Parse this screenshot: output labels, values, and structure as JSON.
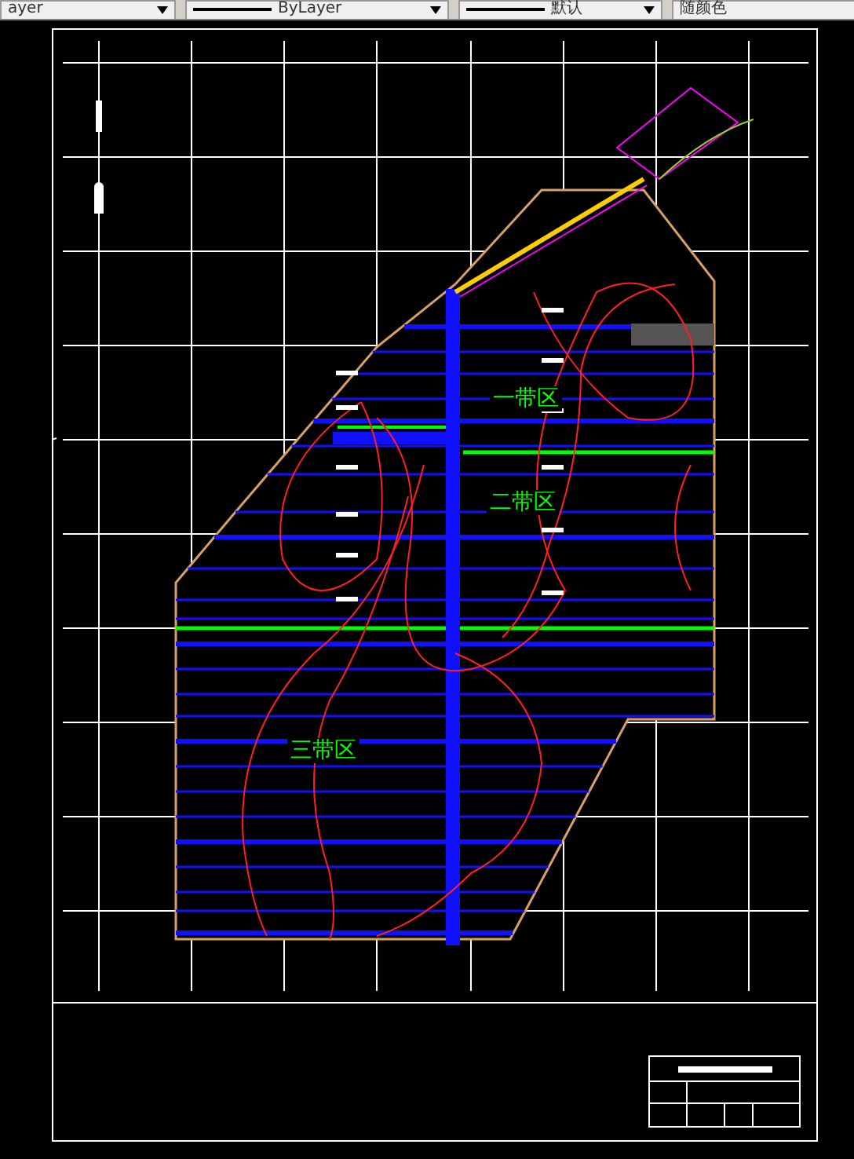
{
  "toolbar": {
    "dropdowns": [
      {
        "label": "ayer",
        "kind": "plain"
      },
      {
        "label": "ByLayer",
        "kind": "linetype"
      },
      {
        "label": "默认",
        "kind": "linetype"
      },
      {
        "label": "随颜色",
        "kind": "plain"
      }
    ]
  },
  "drawing": {
    "zone_labels": [
      {
        "text": "一带区"
      },
      {
        "text": "二带区"
      },
      {
        "text": "三带区"
      }
    ]
  }
}
